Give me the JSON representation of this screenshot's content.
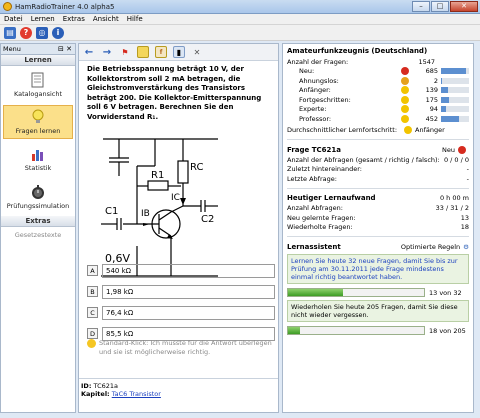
{
  "window": {
    "title": "HamRadioTrainer 4.0 alpha5"
  },
  "menu": [
    "Datei",
    "Lernen",
    "Extras",
    "Ansicht",
    "Hilfe"
  ],
  "sidebar": {
    "header": "Menu",
    "section_lernen": "Lernen",
    "items": [
      {
        "label": "Katalogansicht"
      },
      {
        "label": "Fragen lernen"
      },
      {
        "label": "Statistik"
      },
      {
        "label": "Prüfungssimulation"
      }
    ],
    "section_extras": "Extras",
    "extras_item": "Gesetzestexte"
  },
  "question": {
    "text": "Die Betriebsspannung beträgt 10 V, der Kollektorstrom soll 2 mA betragen, die Gleichstromverstärkung des Transistors beträgt 200. Die Kollektor-Emitterspannung soll 6 V betragen. Berechnen Sie den Vorwiderstand R₁.",
    "circuit": {
      "r1": "R1",
      "rc": "RC",
      "c1": "C1",
      "c2": "C2",
      "ib": "IB",
      "ic": "IC",
      "voltage": "0,6V"
    },
    "answers": [
      {
        "letter": "A",
        "text": "540 kΩ"
      },
      {
        "letter": "B",
        "text": "1,98 kΩ"
      },
      {
        "letter": "C",
        "text": "76,4 kΩ"
      },
      {
        "letter": "D",
        "text": "85,5 kΩ"
      }
    ],
    "hint": "Standard-Klick: Ich musste für die Antwort überlegen und sie ist möglicherweise richtig.",
    "id_label": "ID:",
    "id_value": "TC621a",
    "kapitel_label": "Kapitel:",
    "kapitel_value": "TaC6 Transistor"
  },
  "stats": {
    "title": "Amateurfunkzeugnis (Deutschland)",
    "total_label": "Anzahl der Fragen:",
    "total_value": "1547",
    "levels": [
      {
        "label": "Neu:",
        "value": "685",
        "fill": 0.9,
        "color": "#d62b1f"
      },
      {
        "label": "Ahnungslos:",
        "value": "2",
        "fill": 0.02,
        "color": "#e5a11c"
      },
      {
        "label": "Anfänger:",
        "value": "139",
        "fill": 0.25,
        "color": "#f2c400"
      },
      {
        "label": "Fortgeschritten:",
        "value": "175",
        "fill": 0.3,
        "color": "#f2c400"
      },
      {
        "label": "Experte:",
        "value": "94",
        "fill": 0.18,
        "color": "#f2c400"
      },
      {
        "label": "Professor:",
        "value": "452",
        "fill": 0.65,
        "color": "#f2c400"
      }
    ],
    "avg_label": "Durchschnittlicher Lernfortschritt:",
    "avg_value": "Anfänger"
  },
  "frage": {
    "title": "Frage TC621a",
    "status": "Neu",
    "rows": [
      {
        "label": "Anzahl der Abfragen (gesamt / richtig / falsch):",
        "value": "0 / 0 / 0"
      },
      {
        "label": "Zuletzt hintereinander:",
        "value": "-"
      },
      {
        "label": "Letzte Abfrage:",
        "value": "-"
      }
    ]
  },
  "aufwand": {
    "title": "Heutiger Lernaufwand",
    "title_value": "0 h 00 m",
    "rows": [
      {
        "label": "Anzahl Abfragen:",
        "value": "33 / 31 / 2"
      },
      {
        "label": "Neu gelernte Fragen:",
        "value": "13"
      },
      {
        "label": "Wiederholte Fragen:",
        "value": "18"
      }
    ]
  },
  "assistent": {
    "title": "Lernassistent",
    "mode": "Optimierte Regeln",
    "box1": "Lernen Sie heute 32 neue Fragen, damit Sie bis zur Prüfung am 30.11.2011 jede Frage mindestens einmal richtig beantwortet haben.",
    "bar1_text": "13 von 32",
    "bar1_fill": 0.406,
    "box2": "Wiederholen Sie heute 205 Fragen, damit Sie diese nicht wieder vergessen.",
    "bar2_text": "18 von 205",
    "bar2_fill": 0.088
  }
}
